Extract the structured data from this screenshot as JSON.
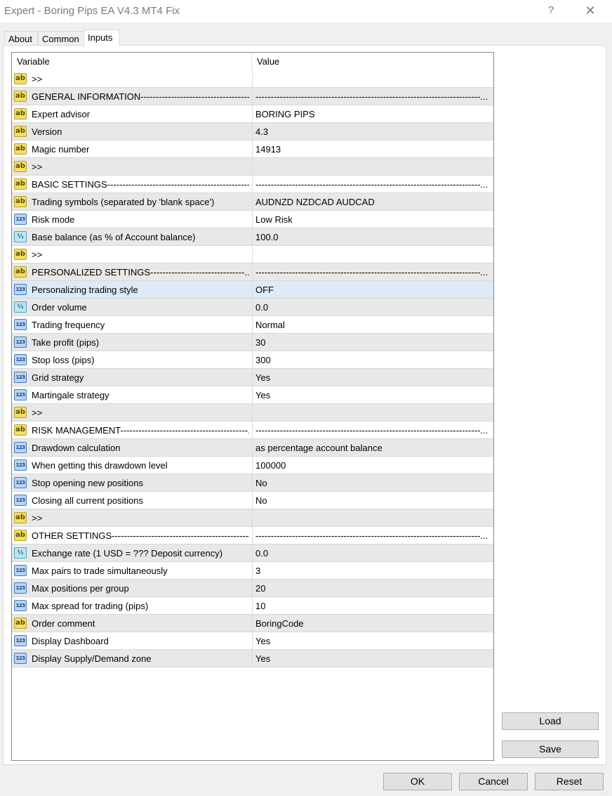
{
  "window": {
    "title": "Expert - Boring Pips EA V4.3 MT4 Fix",
    "help_label": "?",
    "close_label": "✕"
  },
  "tabs": [
    {
      "label": "About",
      "active": false
    },
    {
      "label": "Common",
      "active": false
    },
    {
      "label": "Inputs",
      "active": true
    }
  ],
  "grid": {
    "columns": [
      "Variable",
      "Value"
    ],
    "rows": [
      {
        "icon": "ab",
        "variable": ">>",
        "value": ""
      },
      {
        "icon": "ab",
        "variable": "GENERAL INFORMATION---------------------------------------...",
        "value": "--------------------------------------------------------------------------..."
      },
      {
        "icon": "ab",
        "variable": "Expert advisor",
        "value": "BORING PIPS"
      },
      {
        "icon": "ab",
        "variable": "Version",
        "value": "4.3"
      },
      {
        "icon": "ab",
        "variable": "Magic number",
        "value": "14913"
      },
      {
        "icon": "ab",
        "variable": ">>",
        "value": ""
      },
      {
        "icon": "ab",
        "variable": "BASIC SETTINGS----------------------------------------------------",
        "value": "--------------------------------------------------------------------------..."
      },
      {
        "icon": "ab",
        "variable": "Trading symbols (separated by 'blank space')",
        "value": "AUDNZD NZDCAD AUDCAD"
      },
      {
        "icon": "123",
        "variable": "Risk mode",
        "value": "Low Risk"
      },
      {
        "icon": "half",
        "variable": "Base balance (as % of Account balance)",
        "value": "100.0"
      },
      {
        "icon": "ab",
        "variable": ">>",
        "value": ""
      },
      {
        "icon": "ab",
        "variable": "PERSONALIZED SETTINGS-------------------------------...",
        "value": "--------------------------------------------------------------------------..."
      },
      {
        "icon": "123",
        "variable": "Personalizing trading style",
        "value": "OFF",
        "selected": true
      },
      {
        "icon": "half",
        "variable": "Order volume",
        "value": "0.0"
      },
      {
        "icon": "123",
        "variable": "Trading frequency",
        "value": "Normal"
      },
      {
        "icon": "123",
        "variable": "Take profit (pips)",
        "value": "30"
      },
      {
        "icon": "123",
        "variable": "Stop loss (pips)",
        "value": "300"
      },
      {
        "icon": "123",
        "variable": "Grid strategy",
        "value": "Yes"
      },
      {
        "icon": "123",
        "variable": "Martingale strategy",
        "value": "Yes"
      },
      {
        "icon": "ab",
        "variable": ">>",
        "value": ""
      },
      {
        "icon": "ab",
        "variable": "RISK MANAGEMENT------------------------------------------...",
        "value": "--------------------------------------------------------------------------..."
      },
      {
        "icon": "123",
        "variable": "Drawdown calculation",
        "value": "as percentage account balance"
      },
      {
        "icon": "123",
        "variable": "When getting this drawdown level",
        "value": "100000"
      },
      {
        "icon": "123",
        "variable": "Stop opening new positions",
        "value": "No"
      },
      {
        "icon": "123",
        "variable": "Closing all current positions",
        "value": "No"
      },
      {
        "icon": "ab",
        "variable": ">>",
        "value": ""
      },
      {
        "icon": "ab",
        "variable": "OTHER SETTINGS---------------------------------------------------...",
        "value": "--------------------------------------------------------------------------..."
      },
      {
        "icon": "half",
        "variable": "Exchange rate (1 USD = ??? Deposit currency)",
        "value": "0.0"
      },
      {
        "icon": "123",
        "variable": "Max pairs to trade simultaneously",
        "value": "3"
      },
      {
        "icon": "123",
        "variable": "Max positions per group",
        "value": "20"
      },
      {
        "icon": "123",
        "variable": "Max spread for trading (pips)",
        "value": "10"
      },
      {
        "icon": "ab",
        "variable": "Order comment",
        "value": "BoringCode"
      },
      {
        "icon": "123",
        "variable": "Display Dashboard",
        "value": "Yes"
      },
      {
        "icon": "123",
        "variable": "Display Supply/Demand zone",
        "value": "Yes"
      }
    ]
  },
  "icon_glyphs": {
    "ab": "ab",
    "123": "123",
    "half": "½"
  },
  "side_buttons": {
    "load": "Load",
    "save": "Save"
  },
  "footer_buttons": {
    "ok": "OK",
    "cancel": "Cancel",
    "reset": "Reset"
  },
  "colors": {
    "selected_row": "#dcebf7",
    "alt_row": "#e8e8e8"
  }
}
